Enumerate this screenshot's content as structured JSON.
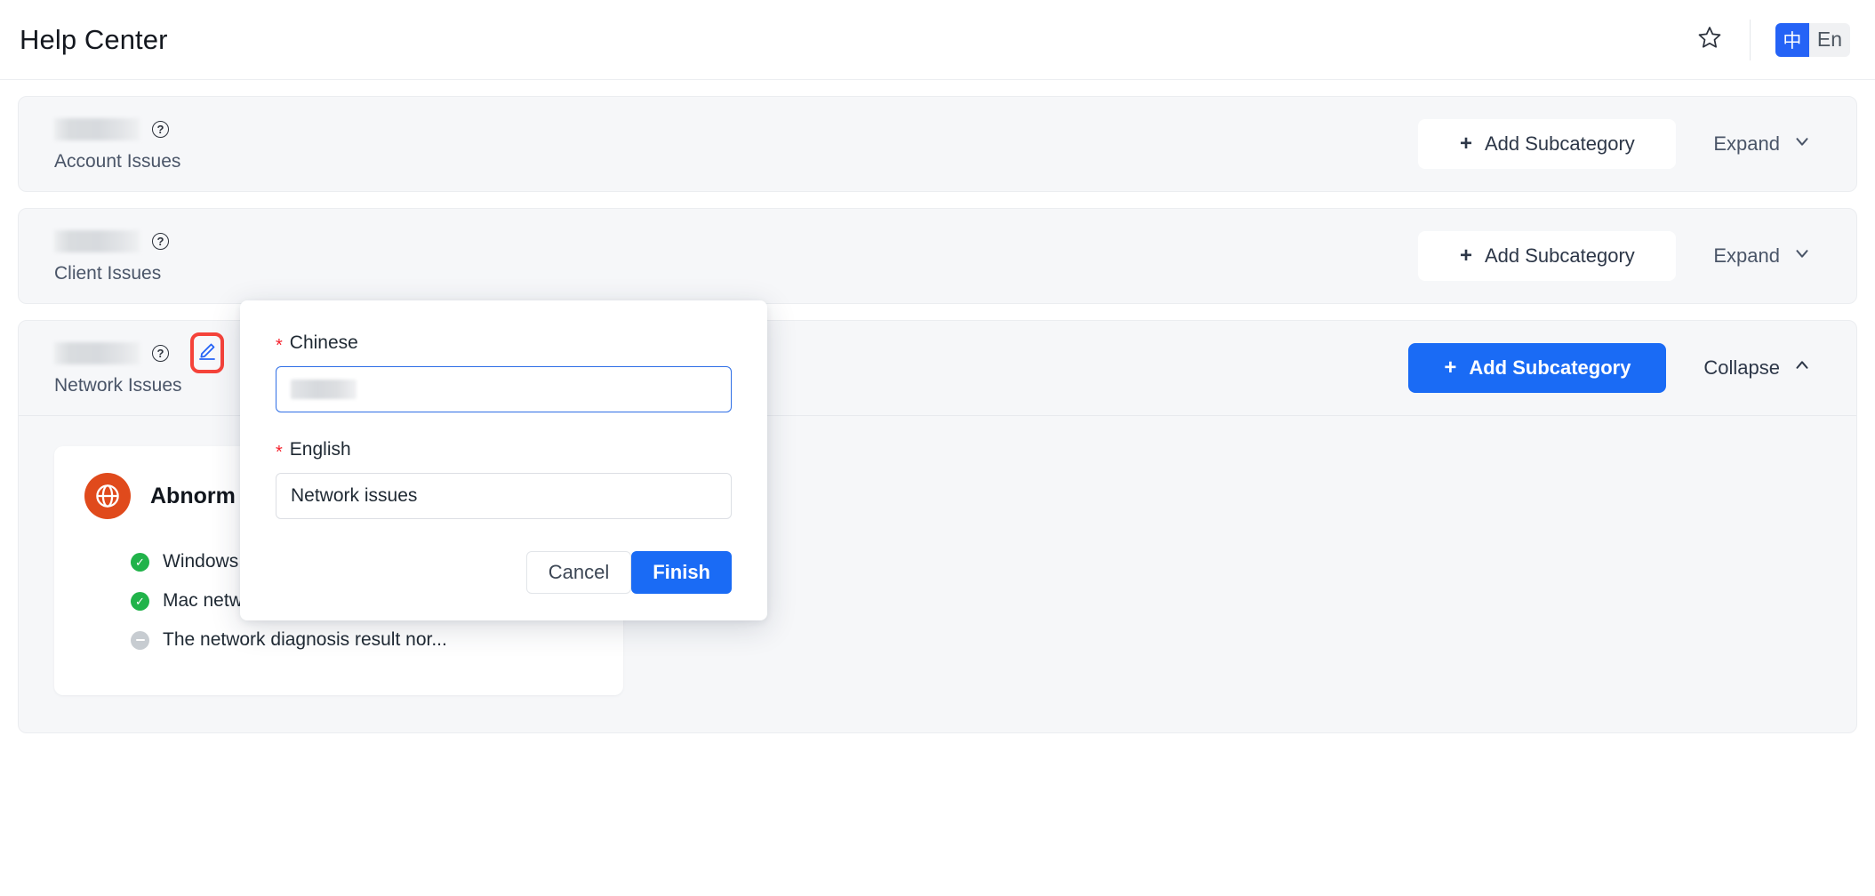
{
  "header": {
    "title": "Help Center",
    "star_icon": "star-icon",
    "language_toggle": {
      "active_label": "中",
      "inactive_label": "En",
      "active_color": "#2563f6"
    }
  },
  "categories": [
    {
      "chinese_name_redacted": true,
      "english_name": "Account Issues",
      "help_icon": "question-circle-icon",
      "add_subcategory_label": "Add Subcategory",
      "add_button_style": "ghost",
      "toggle_label": "Expand",
      "toggle_icon": "chevron-down-icon",
      "expanded": false,
      "editable": false
    },
    {
      "chinese_name_redacted": true,
      "english_name": "Client Issues",
      "help_icon": "question-circle-icon",
      "add_subcategory_label": "Add Subcategory",
      "add_button_style": "ghost",
      "toggle_label": "Expand",
      "toggle_icon": "chevron-down-icon",
      "expanded": false,
      "editable": false
    },
    {
      "chinese_name_redacted": true,
      "english_name": "Network Issues",
      "help_icon": "question-circle-icon",
      "edit_icon": "pencil-edit-icon",
      "edit_highlight_color": "#f5433a",
      "add_subcategory_label": "Add Subcategory",
      "add_button_style": "primary",
      "toggle_label": "Collapse",
      "toggle_icon": "chevron-up-icon",
      "expanded": true,
      "editable": true,
      "subcategory": {
        "icon": "globe-icon",
        "icon_color": "#e04a1c",
        "title": "Abnorm",
        "items": [
          {
            "status": "ok",
            "text": "Windows network display is normal,..."
          },
          {
            "status": "ok",
            "text": "Mac network display is normal, the..."
          },
          {
            "status": "muted",
            "text": "The network diagnosis result nor..."
          }
        ]
      }
    }
  ],
  "modal": {
    "chinese_label": "Chinese",
    "chinese_required_mark": "*",
    "chinese_value_redacted": true,
    "chinese_placeholder": "",
    "english_label": "English",
    "english_required_mark": "*",
    "english_value": "Network issues",
    "english_placeholder": "",
    "cancel_label": "Cancel",
    "finish_label": "Finish",
    "accent_color": "#1a6bf5"
  }
}
